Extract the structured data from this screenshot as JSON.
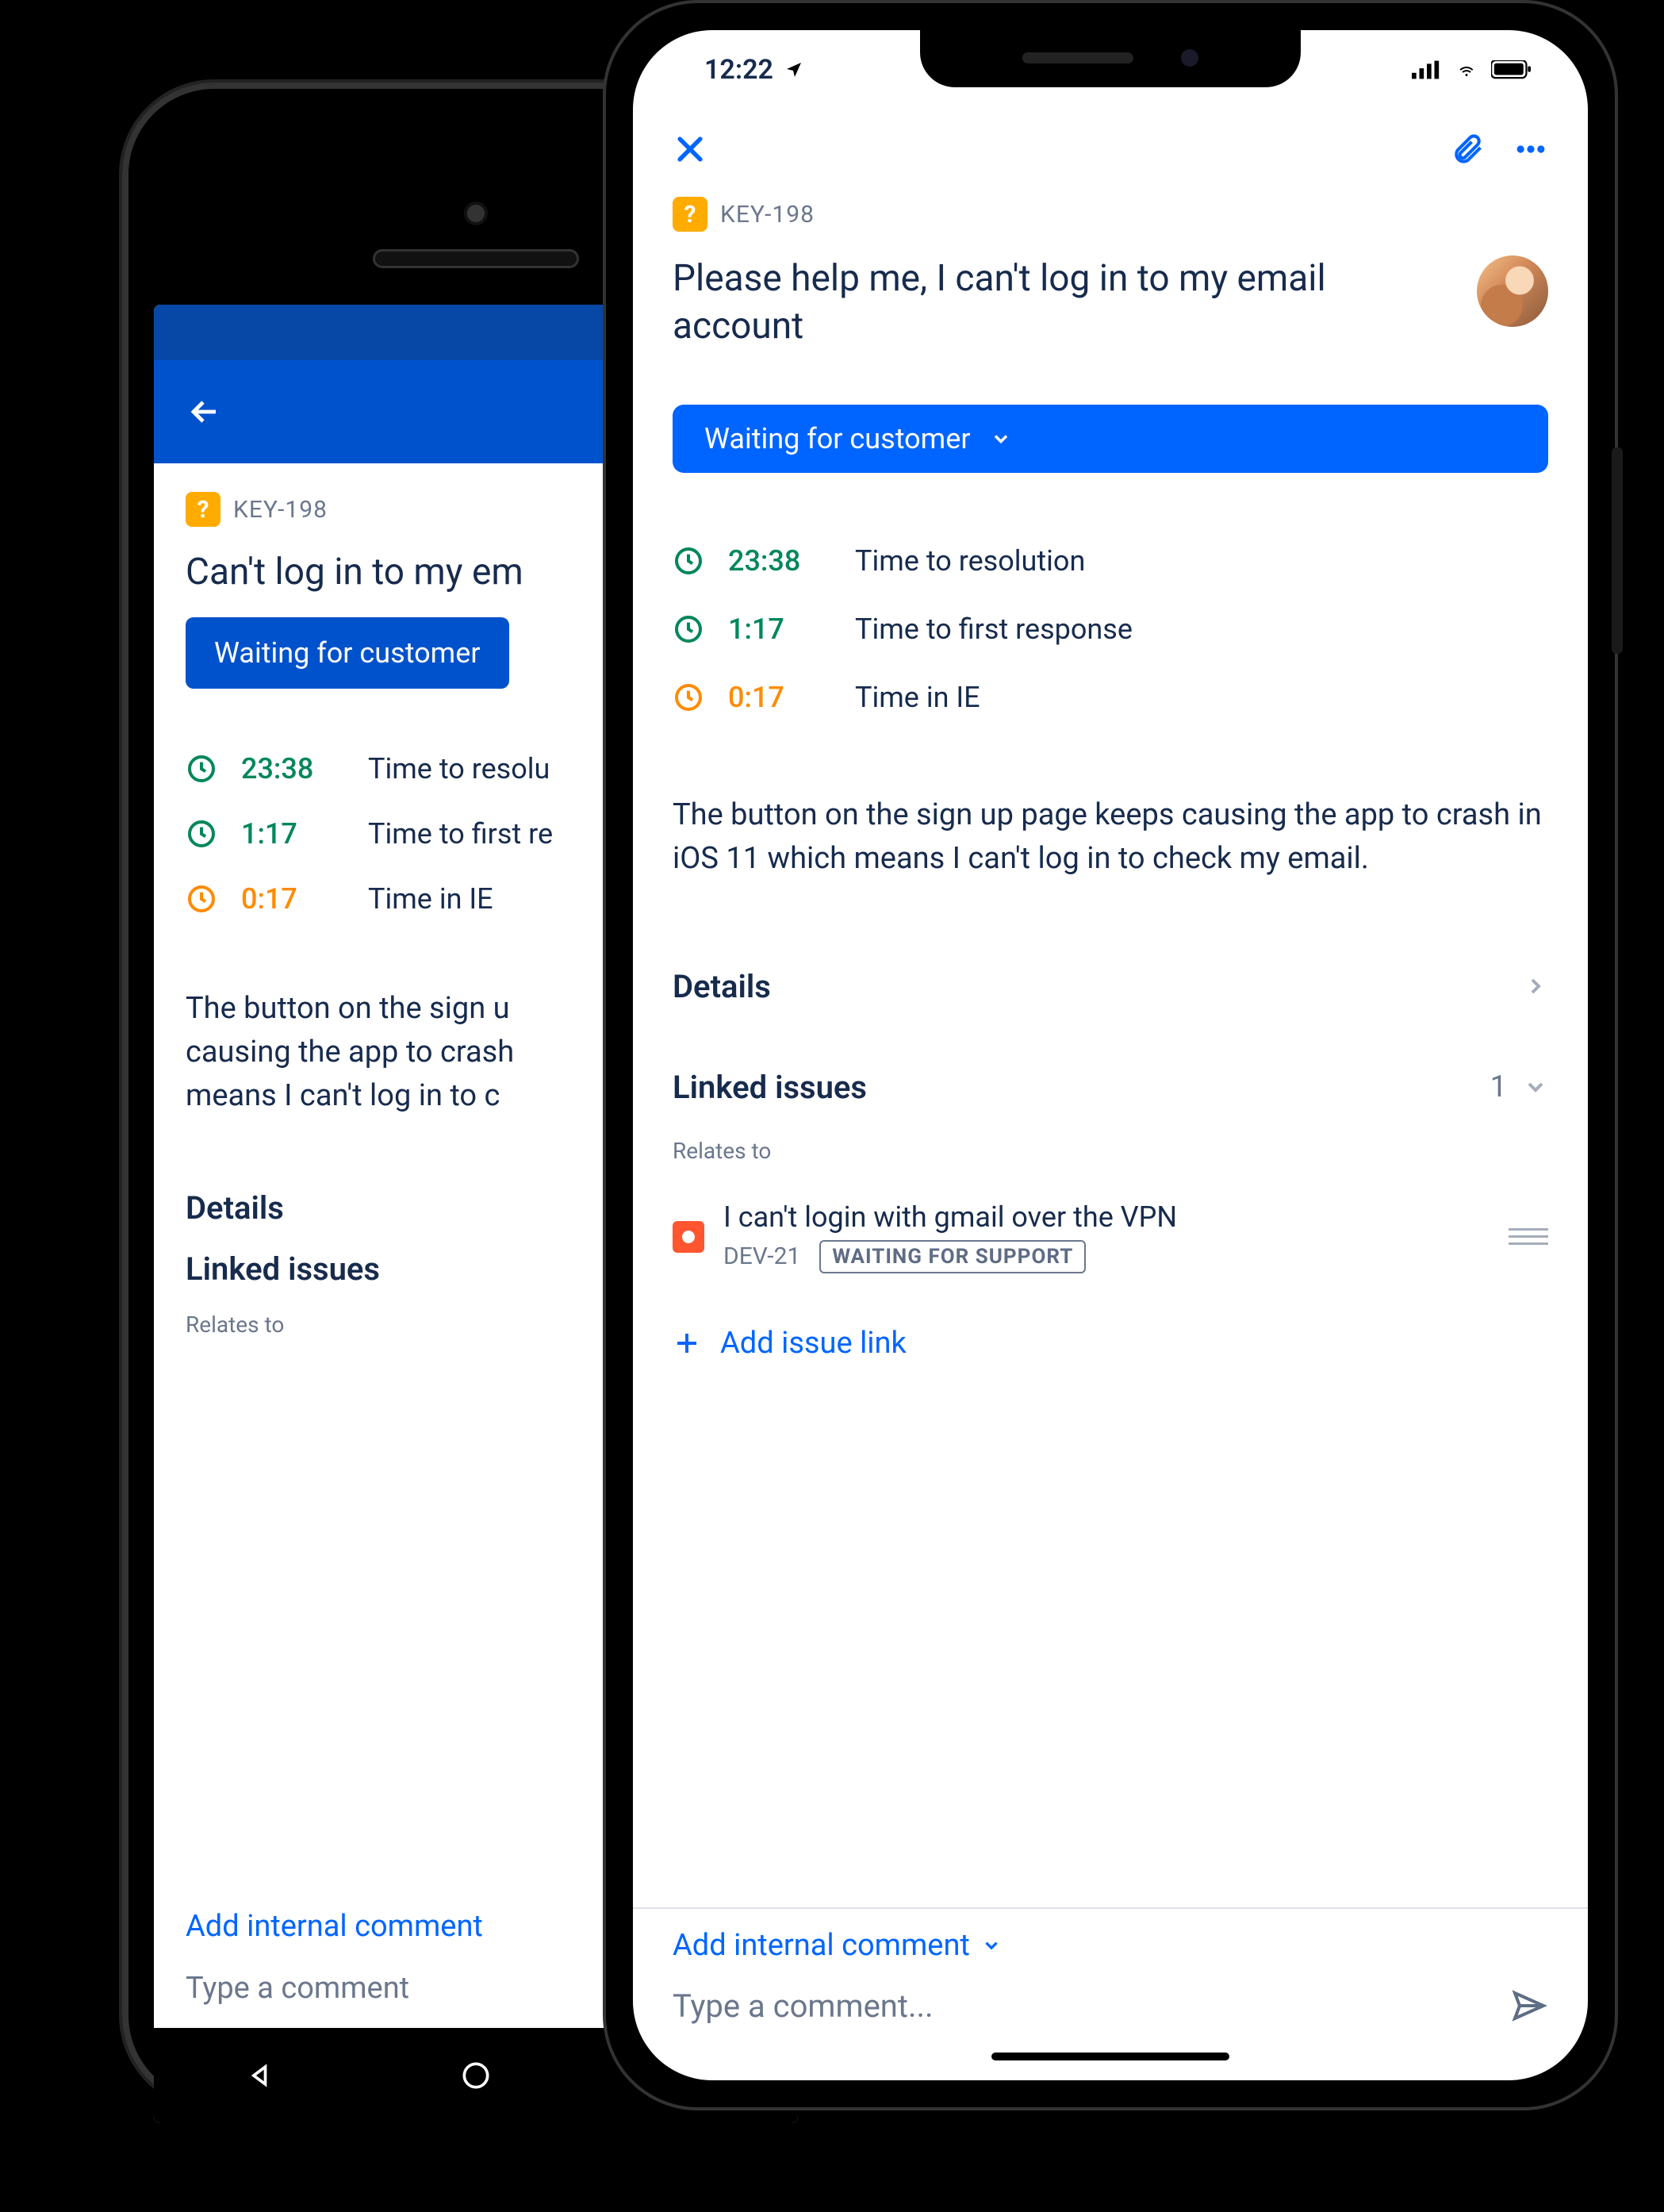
{
  "android": {
    "issue_key": "KEY-198",
    "title": "Can't log in to my em",
    "status_label": "Waiting for customer",
    "sla": [
      {
        "time": "23:38",
        "label": "Time to resolu",
        "color": "green"
      },
      {
        "time": "1:17",
        "label": "Time to first re",
        "color": "green"
      },
      {
        "time": "0:17",
        "label": "Time in IE",
        "color": "orange"
      }
    ],
    "description_lines": [
      "The button on the sign u",
      "causing the app to crash",
      "means I can't log in to c"
    ],
    "details_label": "Details",
    "linked_label": "Linked issues",
    "relates_to": "Relates to",
    "add_comment": "Add internal comment",
    "comment_placeholder": "Type a comment"
  },
  "iphone": {
    "status_time": "12:22",
    "issue_key": "KEY-198",
    "title": "Please help me, I can't log in to my email account",
    "status_label": "Waiting for customer",
    "sla": [
      {
        "time": "23:38",
        "label": "Time to resolution",
        "color": "green"
      },
      {
        "time": "1:17",
        "label": "Time to first response",
        "color": "green"
      },
      {
        "time": "0:17",
        "label": "Time in IE",
        "color": "orange"
      }
    ],
    "description": "The button on the sign up page keeps causing the app to crash in iOS 11 which means I can't log in to check my email.",
    "details_label": "Details",
    "linked_label": "Linked issues",
    "linked_count": "1",
    "relates_to": "Relates to",
    "linked_issue": {
      "title": "I can't login with gmail over the VPN",
      "key": "DEV-21",
      "status": "WAITING FOR SUPPORT"
    },
    "add_link": "Add issue link",
    "comment_selector": "Add internal comment",
    "comment_placeholder": "Type a comment..."
  }
}
